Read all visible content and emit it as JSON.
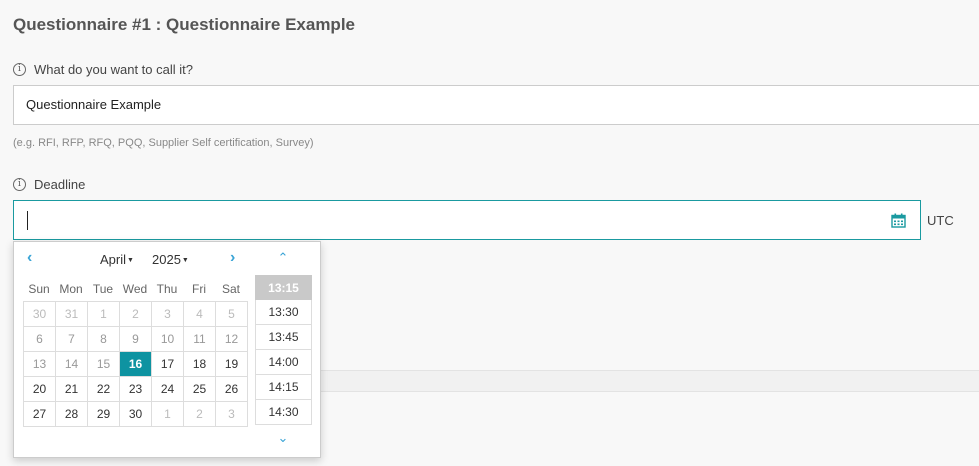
{
  "page": {
    "title": "Questionnaire #1 : Questionnaire Example"
  },
  "name_field": {
    "label": "What do you want to call it?",
    "value": "Questionnaire Example",
    "hint": "(e.g. RFI, RFP, RFQ, PQQ, Supplier Self certification, Survey)"
  },
  "deadline_field": {
    "label": "Deadline",
    "value": "",
    "timezone": "UTC"
  },
  "datepicker": {
    "month": "April",
    "year": "2025",
    "weekdays": [
      "Sun",
      "Mon",
      "Tue",
      "Wed",
      "Thu",
      "Fri",
      "Sat"
    ],
    "weeks": [
      [
        "30",
        "31",
        "1",
        "2",
        "3",
        "4",
        "5"
      ],
      [
        "6",
        "7",
        "8",
        "9",
        "10",
        "11",
        "12"
      ],
      [
        "13",
        "14",
        "15",
        "16",
        "17",
        "18",
        "19"
      ],
      [
        "20",
        "21",
        "22",
        "23",
        "24",
        "25",
        "26"
      ],
      [
        "27",
        "28",
        "29",
        "30",
        "1",
        "2",
        "3"
      ]
    ],
    "selected_day": "16",
    "accent_color": "#0e93a1",
    "times": [
      "13:15",
      "13:30",
      "13:45",
      "14:00",
      "14:15",
      "14:30"
    ],
    "selected_time": "13:15",
    "icons": {
      "prev": "chevron-left-icon",
      "next": "chevron-right-icon",
      "time_up": "chevron-up-icon",
      "time_down": "chevron-down-icon",
      "calendar": "calendar-icon",
      "info": "info-icon"
    }
  }
}
